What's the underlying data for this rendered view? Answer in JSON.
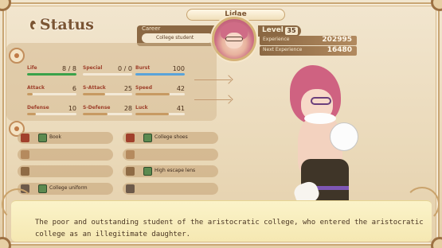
{
  "screen": {
    "title": "Status",
    "character_name": "Lidae",
    "career": {
      "label": "Career",
      "value": "College student"
    },
    "level": {
      "label": "Level",
      "value": "35"
    },
    "experience": {
      "label": "Experience",
      "value": "202995"
    },
    "next_experience": {
      "label": "Next Experience",
      "value": "16480"
    }
  },
  "stats": [
    {
      "key": "life",
      "label": "Life",
      "value": "8",
      "max": "8",
      "fill": 1.0,
      "color": "#3aa24a"
    },
    {
      "key": "special",
      "label": "Special",
      "value": "0",
      "max": "0",
      "fill": 0.0,
      "color": "#4a78c8"
    },
    {
      "key": "burst",
      "label": "Burst",
      "value": "100",
      "max": "",
      "fill": 1.0,
      "color": "#5aa3d9"
    },
    {
      "key": "attack",
      "label": "Attack",
      "value": "6",
      "max": "",
      "fill": 0.12,
      "color": "#c79a62"
    },
    {
      "key": "s_attack",
      "label": "S-Attack",
      "value": "25",
      "max": "",
      "fill": 0.45,
      "color": "#c79a62"
    },
    {
      "key": "speed",
      "label": "Speed",
      "value": "42",
      "max": "",
      "fill": 0.7,
      "color": "#c79a62"
    },
    {
      "key": "defense",
      "label": "Defense",
      "value": "10",
      "max": "",
      "fill": 0.18,
      "color": "#c79a62"
    },
    {
      "key": "s_defense",
      "label": "S-Defense",
      "value": "28",
      "max": "",
      "fill": 0.5,
      "color": "#c79a62"
    },
    {
      "key": "luck",
      "label": "Luck",
      "value": "41",
      "max": "",
      "fill": 0.68,
      "color": "#c79a62"
    }
  ],
  "equipment": {
    "left": [
      {
        "key": "weapon",
        "name": "Book",
        "icon": "book-icon",
        "empty": false
      },
      {
        "key": "accessory",
        "name": "",
        "icon": "slot-icon",
        "empty": true
      },
      {
        "key": "gloves",
        "name": "",
        "icon": "glove-icon",
        "empty": true
      },
      {
        "key": "top",
        "name": "College uniform",
        "icon": "shirt-icon",
        "empty": false
      }
    ],
    "right": [
      {
        "key": "shoes",
        "name": "College shoes",
        "icon": "boot-icon",
        "empty": false
      },
      {
        "key": "legs",
        "name": "",
        "icon": "legs-icon",
        "empty": true
      },
      {
        "key": "socks",
        "name": "High escape lens",
        "icon": "sock-icon",
        "empty": false
      },
      {
        "key": "ring",
        "name": "",
        "icon": "ring-icon",
        "empty": true
      }
    ]
  },
  "dialog": {
    "text": "The poor and outstanding student of the aristocratic college, who entered the aristocratic college as an illegitimate daughter."
  },
  "colors": {
    "panel_brown": "#8b6843",
    "accent_red": "#9e3f2a",
    "dialog_bg": "#f7ebb9"
  }
}
